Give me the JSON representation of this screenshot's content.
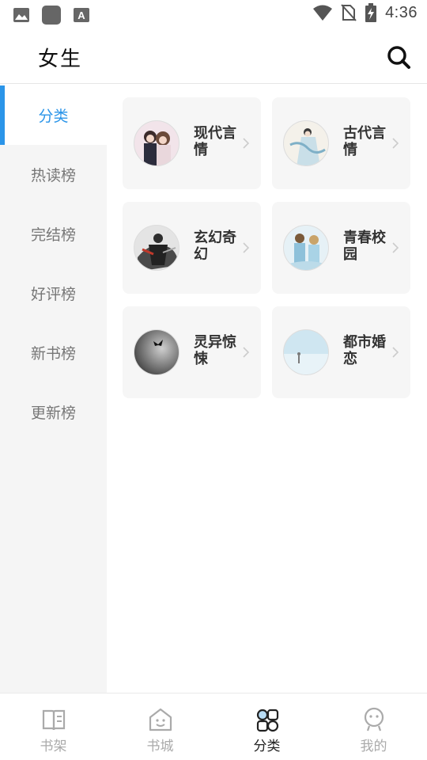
{
  "status_bar": {
    "time": "4:36"
  },
  "header": {
    "title": "女生"
  },
  "sidebar": {
    "items": [
      {
        "label": "分类",
        "active": true
      },
      {
        "label": "热读榜",
        "active": false
      },
      {
        "label": "完结榜",
        "active": false
      },
      {
        "label": "好评榜",
        "active": false
      },
      {
        "label": "新书榜",
        "active": false
      },
      {
        "label": "更新榜",
        "active": false
      }
    ]
  },
  "categories": [
    {
      "label": "现代言情",
      "icon": "modern-romance-cover"
    },
    {
      "label": "古代言情",
      "icon": "ancient-romance-cover"
    },
    {
      "label": "玄幻奇幻",
      "icon": "fantasy-cover"
    },
    {
      "label": "青春校园",
      "icon": "campus-youth-cover"
    },
    {
      "label": "灵异惊悚",
      "icon": "supernatural-thriller-cover"
    },
    {
      "label": "都市婚恋",
      "icon": "urban-marriage-cover"
    }
  ],
  "tabbar": {
    "tabs": [
      {
        "label": "书架",
        "icon": "book-icon",
        "active": false
      },
      {
        "label": "书城",
        "icon": "store-house-icon",
        "active": false
      },
      {
        "label": "分类",
        "icon": "category-grid-icon",
        "active": true
      },
      {
        "label": "我的",
        "icon": "profile-face-icon",
        "active": false
      }
    ]
  },
  "colors": {
    "accent": "#2b95e9",
    "sidebar_bg": "#f5f5f5",
    "card_bg": "#f6f6f6",
    "inactive_text": "#777777"
  }
}
